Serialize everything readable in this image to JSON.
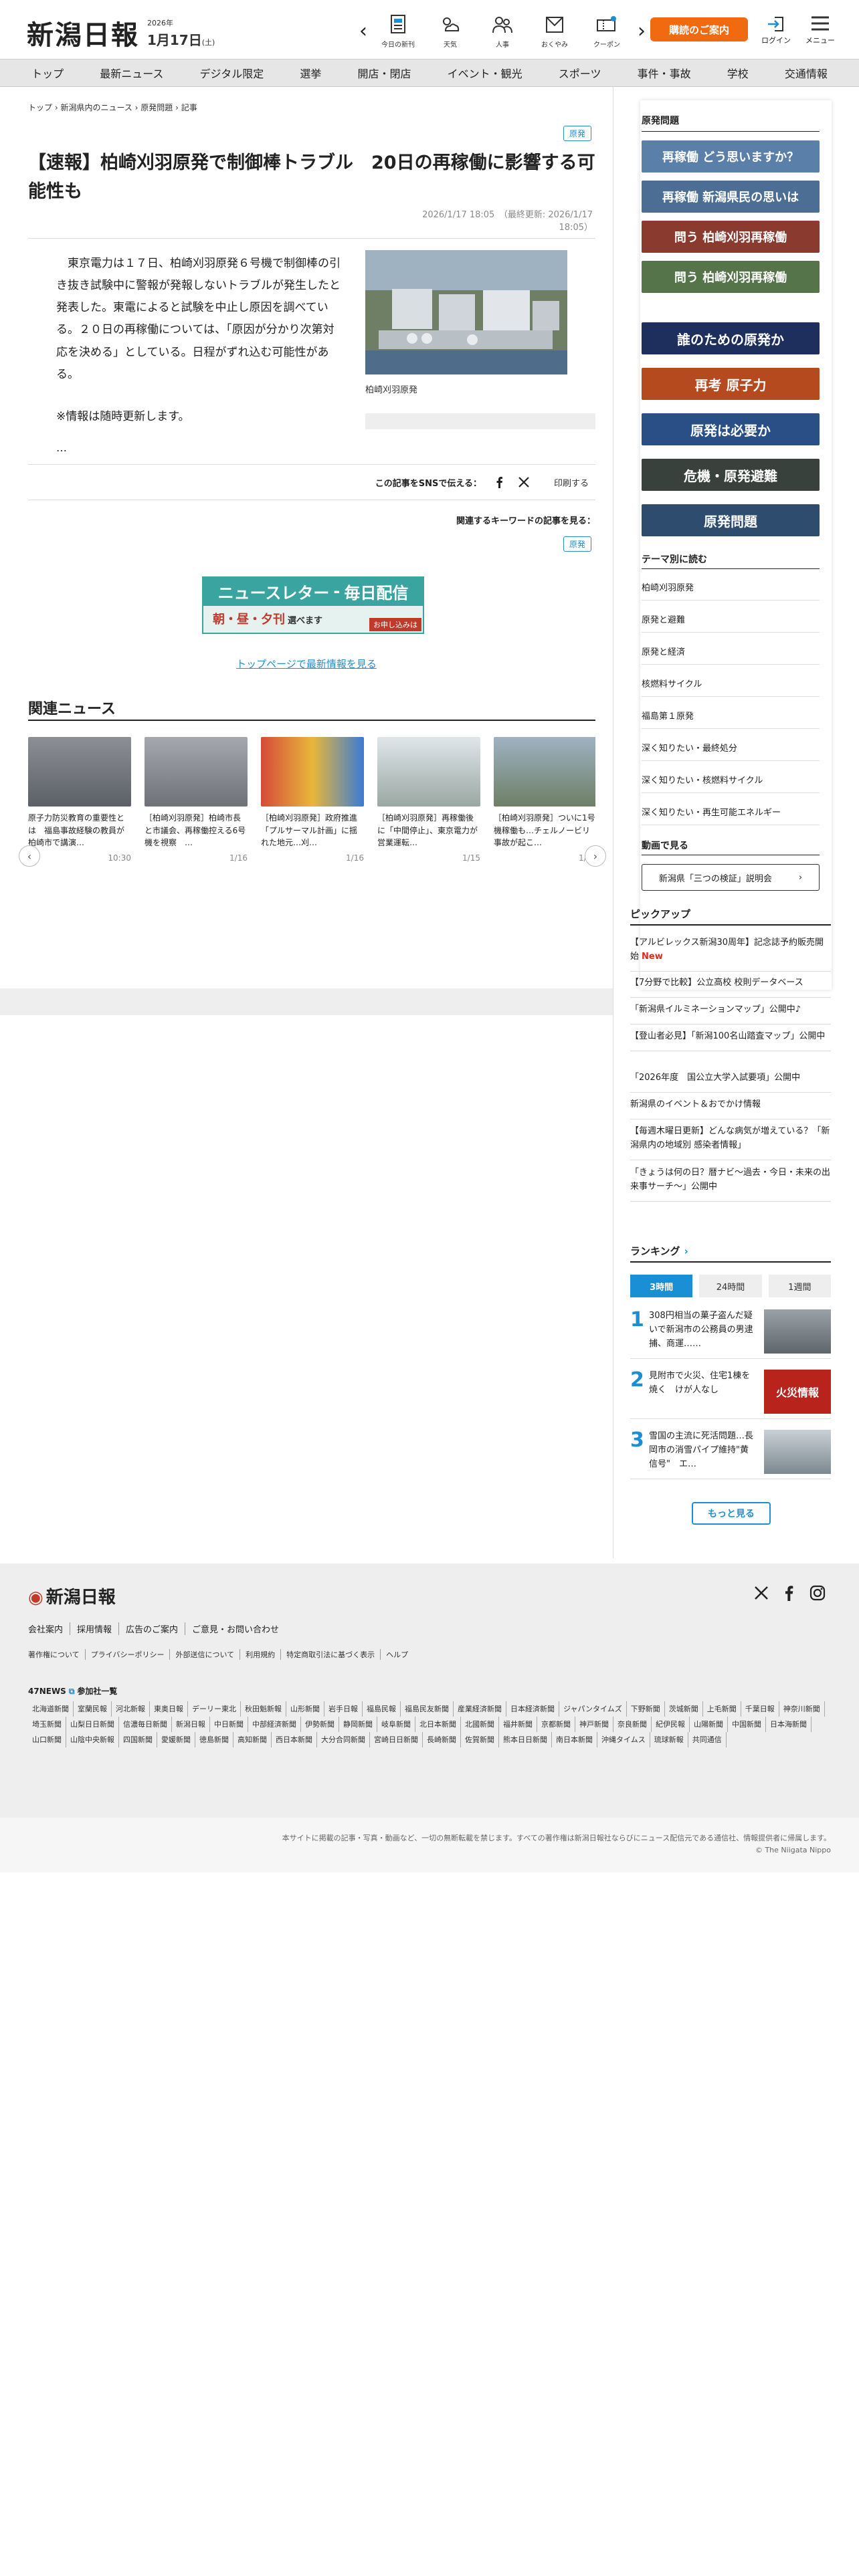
{
  "header": {
    "logo": "新潟日報",
    "year": "2026年",
    "month_day": "1月17日",
    "weekday": "(土)",
    "icons": [
      {
        "label": "今日の新刊",
        "icon": "newspaper-icon"
      },
      {
        "label": "天気",
        "icon": "weather-icon"
      },
      {
        "label": "人事",
        "icon": "people-icon"
      },
      {
        "label": "おくやみ",
        "icon": "condolence-icon"
      },
      {
        "label": "クーポン",
        "icon": "coupon-icon"
      }
    ],
    "subscribe": "購読のご案内",
    "login": "ログイン",
    "menu": "メニュー"
  },
  "gnav": [
    "トップ",
    "最新ニュース",
    "デジタル限定",
    "選挙",
    "開店・閉店",
    "イベント・観光",
    "スポーツ",
    "事件・事故",
    "学校",
    "交通情報"
  ],
  "article": {
    "breadcrumb": [
      "トップ",
      "新潟県内のニュース",
      "原発問題",
      "記事"
    ],
    "tag": "原発",
    "title": "【速報】柏崎刈羽原発で制御棒トラブル　20日の再稼働に影響する可能性も",
    "pubdate": "2026/1/17 18:05　（最終更新: 2026/1/17 18:05）",
    "body": [
      "　東京電力は１７日、柏崎刈羽原発６号機で制御棒の引き抜き試験中に警報が発報しないトラブルが発生したと発表した。東電によると試験を中止し原因を調べている。２０日の再稼働については、「原因が分かり次第対応を決める」としている。日程がずれ込む可能性がある。",
      "※情報は随時更新します。"
    ],
    "dots": "…",
    "photo_caption": "柏崎刈羽原発",
    "share_label": "この記事をSNSで伝える：",
    "print": "印刷する",
    "keywords_label": "関連するキーワードの記事を見る：",
    "newsletter_1": "ニュースレター",
    "newsletter_2": "毎日配信",
    "newsletter_3": "朝・昼・夕刊",
    "newsletter_4": "選べます",
    "newsletter_5": "お申し込みは",
    "top_link": "トップページで最新情報を見る"
  },
  "related": {
    "title": "関連ニュース",
    "items": [
      {
        "title": "原子力防災教育の重要性とは　福島事故経験の教員が柏崎市で講演…",
        "date": "10:30"
      },
      {
        "title": "［柏崎刈羽原発］柏崎市長と市議会、再稼働控える6号機を視察　…",
        "date": "1/16"
      },
      {
        "title": "［柏崎刈羽原発］政府推進「プルサーマル計画」に揺れた地元…刈…",
        "date": "1/16"
      },
      {
        "title": "［柏崎刈羽原発］再稼働後に「中間停止」、東京電力が 営業運転…",
        "date": "1/15"
      },
      {
        "title": "［柏崎刈羽原発］ついに1号機稼働も…チェルノービリ事故が起こ…",
        "date": "1/15"
      }
    ]
  },
  "sidebar": {
    "section_title": "原発問題",
    "banners": [
      {
        "text": "再稼働 どう思いますか？",
        "color": "#5a7fa8"
      },
      {
        "text": "再稼働 新潟県民の思いは",
        "color": "#4d6e94"
      },
      {
        "text": "問う 柏崎刈羽再稼働",
        "color": "#8a3a2e"
      },
      {
        "text": "問う 柏崎刈羽再稼働",
        "color": "#55744a"
      },
      {
        "text": "誰のための原発か",
        "color": "#1e2f5e"
      },
      {
        "text": "再考 原子力",
        "color": "#b44a1e"
      },
      {
        "text": "原発は必要か",
        "color": "#2a4f86"
      },
      {
        "text": "危機・原発避難",
        "color": "#39413c"
      },
      {
        "text": "原発問題",
        "color": "#2e4c6e"
      }
    ],
    "theme_title": "テーマ別に読む",
    "themes": [
      "柏崎刈羽原発",
      "原発と避難",
      "原発と経済",
      "核燃料サイクル",
      "福島第１原発",
      "深く知りたい・最終処分",
      "深く知りたい・核燃料サイクル",
      "深く知りたい・再生可能エネルギー"
    ],
    "video_title": "動画で見る",
    "video_button": "新潟県「三つの検証」説明会"
  },
  "pickup": {
    "title": "ピックアップ",
    "items": [
      {
        "text": "【アルビレックス新潟30周年】記念誌予約販売開始",
        "new": "New"
      },
      {
        "text": "【7分野で比較】公立高校 校則データベース",
        "new": ""
      },
      {
        "text": "「新潟県イルミネーションマップ」公開中♪",
        "new": ""
      },
      {
        "text": "【登山者必見】「新潟100名山踏査マップ」公開中",
        "new": ""
      },
      {
        "text": "「2026年度　国公立大学入試要項」公開中",
        "new": ""
      },
      {
        "text": "新潟県のイベント＆おでかけ情報",
        "new": ""
      },
      {
        "text": "【毎週木曜日更新】どんな病気が増えている？「新潟県内の地域別 感染者情報」",
        "new": ""
      },
      {
        "text": "「きょうは何の日？暦ナビ～過去・今日・未来の出来事サーチ～」公開中",
        "new": ""
      }
    ]
  },
  "ranking": {
    "title": "ランキング",
    "tabs": [
      "3時間",
      "24時間",
      "1週間"
    ],
    "items": [
      {
        "num": "1",
        "text": "308円相当の菓子盗んだ疑いで新潟市の公務員の男逮捕、商運……"
      },
      {
        "num": "2",
        "text": "見附市で火災、住宅1棟を焼く　けが人なし"
      },
      {
        "num": "3",
        "text": "雪国の主流に死活問題…長岡市の消雪パイプ維持\"黄信号\"　エ…"
      }
    ],
    "rank2_image_text": "火災情報",
    "more": "もっと見る"
  },
  "footer": {
    "logo": "新潟日報",
    "links": [
      "会社案内",
      "採用情報",
      "広告のご案内",
      "ご意見・お問い合わせ"
    ],
    "links2": [
      "著作権について",
      "プライバシーポリシー",
      "外部送信について",
      "利用規約",
      "特定商取引法に基づく表示",
      "ヘルプ"
    ],
    "n47": "47NEWS",
    "n47_suffix": "参加社一覧",
    "papers": [
      "北海道新聞",
      "室蘭民報",
      "河北新報",
      "東奥日報",
      "デーリー東北",
      "秋田魁新報",
      "山形新聞",
      "岩手日報",
      "福島民報",
      "福島民友新聞",
      "産業経済新聞",
      "日本経済新聞",
      "ジャパンタイムズ",
      "下野新聞",
      "茨城新聞",
      "上毛新聞",
      "千葉日報",
      "神奈川新聞",
      "埼玉新聞",
      "山梨日日新聞",
      "信濃毎日新聞",
      "新潟日報",
      "中日新聞",
      "中部経済新聞",
      "伊勢新聞",
      "静岡新聞",
      "岐阜新聞",
      "北日本新聞",
      "北國新聞",
      "福井新聞",
      "京都新聞",
      "神戸新聞",
      "奈良新聞",
      "紀伊民報",
      "山陽新聞",
      "中国新聞",
      "日本海新聞",
      "山口新聞",
      "山陰中央新報",
      "四国新聞",
      "愛媛新聞",
      "徳島新聞",
      "高知新聞",
      "西日本新聞",
      "大分合同新聞",
      "宮崎日日新聞",
      "長崎新聞",
      "佐賀新聞",
      "熊本日日新聞",
      "南日本新聞",
      "沖縄タイムス",
      "琉球新報",
      "共同通信"
    ],
    "copyright1": "本サイトに掲載の記事・写真・動画など、一切の無断転載を禁じます。すべての著作権は新潟日報社ならびにニュース配信元である通信社、情報提供者に帰属します。",
    "copyright2": "© The Niigata Nippo"
  }
}
